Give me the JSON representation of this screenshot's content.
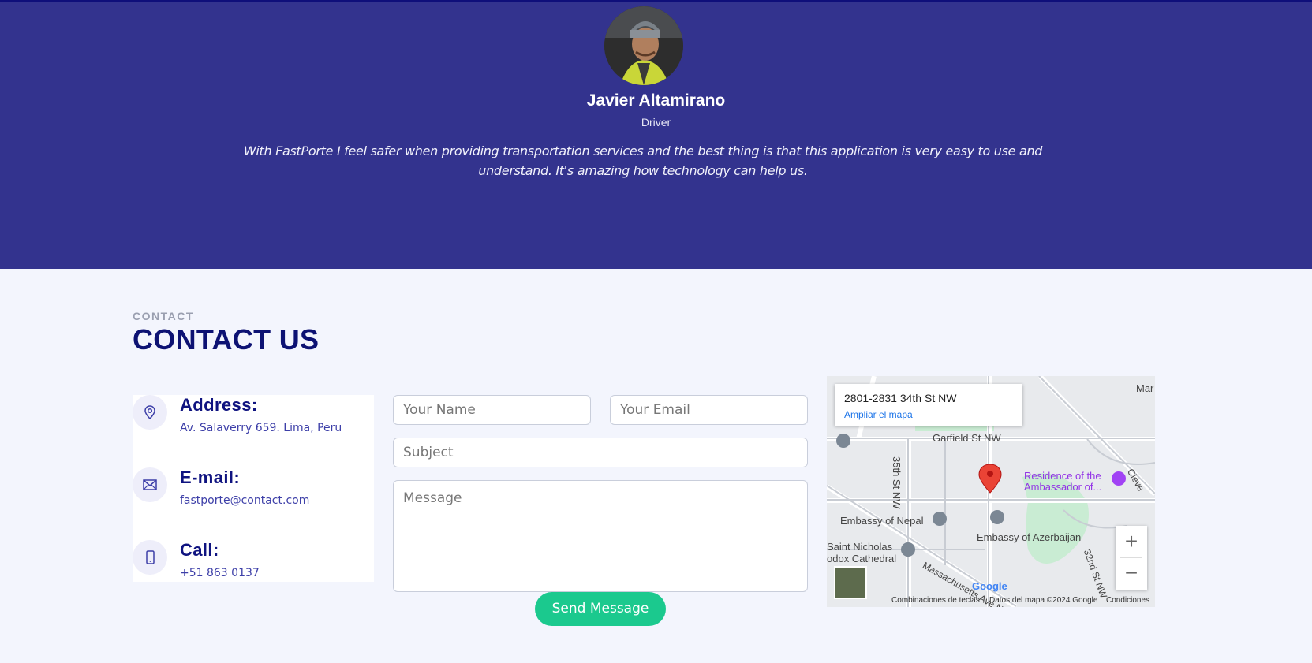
{
  "testimonial": {
    "name": "Javier Altamirano",
    "role": "Driver",
    "quote": "With FastPorte I feel safer when providing transportation services and the best thing is that this application is very easy to use and understand. It's amazing how technology can help us."
  },
  "contact": {
    "eyebrow": "CONTACT",
    "title": "CONTACT US",
    "address": {
      "title": "Address:",
      "value": "Av. Salaverry 659. Lima, Peru"
    },
    "email": {
      "title": "E-mail:",
      "value": "fastporte@contact.com"
    },
    "call": {
      "title": "Call:",
      "value": "+51 863 0137"
    }
  },
  "form": {
    "name_placeholder": "Your Name",
    "email_placeholder": "Your Email",
    "subject_placeholder": "Subject",
    "message_placeholder": "Message",
    "send_label": "Send Message"
  },
  "map": {
    "address": "2801-2831 34th St NW",
    "enlarge_link": "Ampliar el mapa",
    "labels": {
      "garfield": "Garfield St NW",
      "st35": "35th St NW",
      "residence": "Residence of the\nAmbassador of...",
      "nepal": "Embassy of Nepal",
      "azerbaijan": "Embassy of Azerbaijan",
      "nicholas": "Saint Nicholas\nodox Cathedral",
      "mass": "Massachusetts Ave NW",
      "mar": "Mar",
      "st32": "32nd St NW",
      "cleve": "Cleve"
    },
    "zoom_in": "+",
    "zoom_out": "−",
    "google": "Google",
    "footer": {
      "shortcuts": "Combinaciones de teclas",
      "data": "Datos del mapa ©2024 Google",
      "terms": "Condiciones"
    }
  }
}
